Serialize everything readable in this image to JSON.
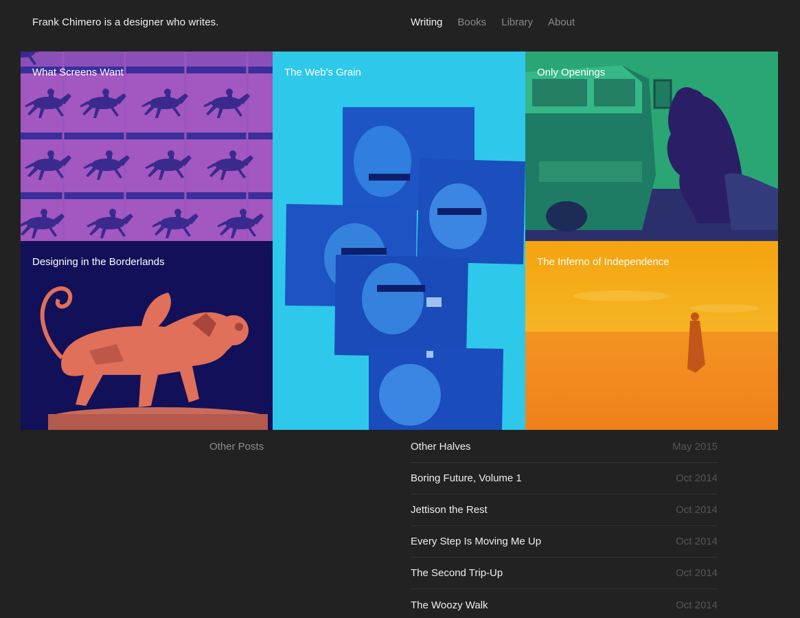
{
  "header": {
    "site_title": "Frank Chimero is a designer who writes.",
    "nav": [
      {
        "label": "Writing",
        "active": true
      },
      {
        "label": "Books",
        "active": false
      },
      {
        "label": "Library",
        "active": false
      },
      {
        "label": "About",
        "active": false
      }
    ]
  },
  "features": [
    {
      "title": "What Screens Want",
      "tint": "#8a4fb8"
    },
    {
      "title": "The Web's Grain",
      "tint": "#2ec8ea"
    },
    {
      "title": "Only Openings",
      "tint": "#2aa574"
    },
    {
      "title": "Designing in the Borderlands",
      "tint": "#121058"
    },
    {
      "title": "The Inferno of Independence",
      "tint": "#f2a112"
    }
  ],
  "other_posts": {
    "label": "Other Posts",
    "items": [
      {
        "title": "Other Halves",
        "date": "May 2015"
      },
      {
        "title": "Boring Future, Volume 1",
        "date": "Oct 2014"
      },
      {
        "title": "Jettison the Rest",
        "date": "Oct 2014"
      },
      {
        "title": "Every Step Is Moving Me Up",
        "date": "Oct 2014"
      },
      {
        "title": "The Second Trip-Up",
        "date": "Oct 2014"
      },
      {
        "title": "The Woozy Walk",
        "date": "Oct 2014"
      }
    ]
  }
}
